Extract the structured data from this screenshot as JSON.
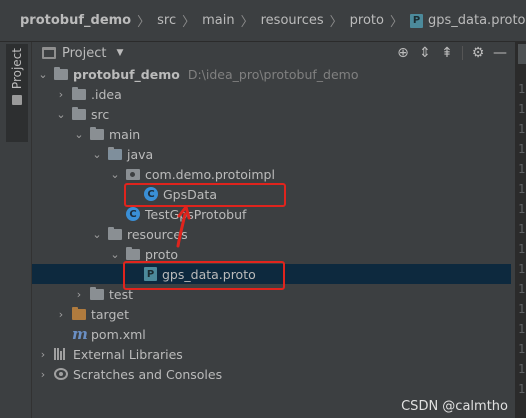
{
  "breadcrumb": {
    "items": [
      "protobuf_demo",
      "src",
      "main",
      "resources",
      "proto"
    ],
    "file": "gps_data.proto",
    "file_icon_letter": "P"
  },
  "toolstrip": {
    "label": "Project"
  },
  "panel": {
    "title": "Project",
    "tools": [
      "target-icon",
      "expand-all-icon",
      "collapse-all-icon",
      "gear-icon",
      "hide-icon"
    ]
  },
  "tree": [
    {
      "label": "protobuf_demo",
      "path": "D:\\idea_pro\\protobuf_demo",
      "icon": "project-folder-icon"
    },
    {
      "label": ".idea",
      "icon": "folder-icon"
    },
    {
      "label": "src",
      "icon": "folder-icon"
    },
    {
      "label": "main",
      "icon": "folder-icon"
    },
    {
      "label": "java",
      "icon": "source-folder-icon"
    },
    {
      "label": "com.demo.protoimpl",
      "icon": "package-icon"
    },
    {
      "label": "GpsData",
      "icon": "class-icon",
      "icon_letter": "C"
    },
    {
      "label": "TestGpsProtobuf",
      "icon": "class-icon",
      "icon_letter": "C"
    },
    {
      "label": "resources",
      "icon": "resources-folder-icon"
    },
    {
      "label": "proto",
      "icon": "folder-icon"
    },
    {
      "label": "gps_data.proto",
      "icon": "proto-file-icon",
      "icon_letter": "P"
    },
    {
      "label": "test",
      "icon": "folder-icon"
    },
    {
      "label": "target",
      "icon": "excluded-folder-icon"
    },
    {
      "label": "pom.xml",
      "icon": "maven-icon",
      "icon_letter": "m"
    },
    {
      "label": "External Libraries",
      "icon": "libraries-icon"
    },
    {
      "label": "Scratches and Consoles",
      "icon": "scratches-icon"
    }
  ],
  "gutter_numbers": [
    "1",
    "1",
    "1",
    "1",
    "1",
    "1",
    "1",
    "1",
    "1",
    "1",
    "1",
    "1",
    "1",
    "1",
    "1",
    "1"
  ],
  "watermark": "CSDN @calmtho",
  "colors": {
    "selection": "#0d293e",
    "highlight": "#e0241d",
    "class_icon": "#3a8fd6",
    "excluded_folder": "#b07b3e"
  }
}
